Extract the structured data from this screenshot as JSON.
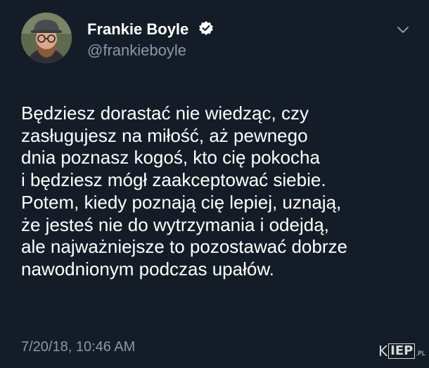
{
  "tweet": {
    "author": {
      "display_name": "Frankie Boyle",
      "handle": "@frankieboyle",
      "verified": true,
      "avatar_icon": "bearded-man-glasses-cap-avatar"
    },
    "body_lines": [
      "Będziesz dorastać nie wiedząc, czy",
      "zasługujesz na miłość, aż pewnego",
      "dnia poznasz kogoś, kto cię pokocha",
      "i będziesz mógł zaakceptować siebie.",
      "Potem, kiedy poznają cię lepiej, uznają,",
      "że jesteś nie do wytrzymania i odejdą,",
      "ale najważniejsze to pozostawać dobrze",
      "nawodnionym podczas upałów."
    ],
    "timestamp": "7/20/18, 10:46 AM",
    "menu_icon": "chevron-down-icon"
  },
  "watermark": {
    "left": "K",
    "box": "IEP",
    "suffix": ".PL"
  },
  "colors": {
    "background": "#141d27",
    "secondary_text": "#8899a6",
    "primary_text": "#ffffff"
  }
}
